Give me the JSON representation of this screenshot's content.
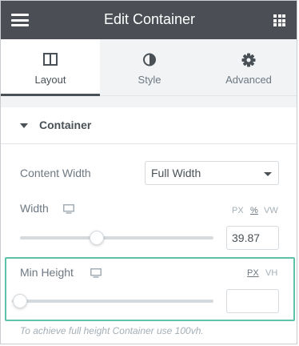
{
  "header": {
    "title": "Edit Container",
    "menu_icon": "hamburger-menu-icon",
    "apps_icon": "grid-apps-icon",
    "background": "#4b4f55"
  },
  "tabs": [
    {
      "label": "Layout",
      "icon": "layout-columns-icon",
      "active": true
    },
    {
      "label": "Style",
      "icon": "half-circle-contrast-icon",
      "active": false
    },
    {
      "label": "Advanced",
      "icon": "gear-icon",
      "active": false
    }
  ],
  "section": {
    "title": "Container",
    "caret_icon": "caret-down-icon"
  },
  "content_width": {
    "label": "Content Width",
    "value": "Full Width"
  },
  "width": {
    "label": "Width",
    "device_icon": "desktop-monitor-icon",
    "units": [
      "PX",
      "%",
      "VW"
    ],
    "active_unit": "%",
    "value": "39.87"
  },
  "min_height": {
    "label": "Min Height",
    "device_icon": "desktop-monitor-icon",
    "units": [
      "PX",
      "VH"
    ],
    "active_unit": "PX",
    "value": "",
    "help": "To achieve full height Container use 100vh."
  },
  "colors": {
    "highlight": "#5cc3a8",
    "text": "#6d7882"
  }
}
